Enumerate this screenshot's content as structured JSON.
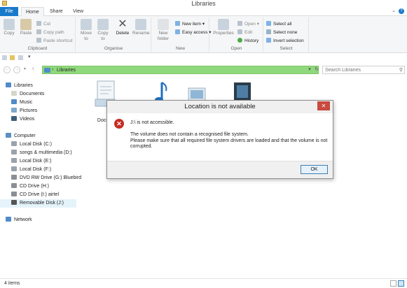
{
  "window": {
    "title": "Libraries"
  },
  "tabs": {
    "file": "File",
    "home": "Home",
    "share": "Share",
    "view": "View",
    "help": "?",
    "expand": "⌄"
  },
  "ribbon": {
    "clipboard": {
      "label": "Clipboard",
      "copy": "Copy",
      "paste": "Paste",
      "cut": "Cut",
      "copy_path": "Copy path",
      "paste_shortcut": "Paste shortcut"
    },
    "organise": {
      "label": "Organise",
      "move_to": "Move to",
      "copy_to": "Copy to",
      "delete": "Delete",
      "rename": "Rename"
    },
    "new": {
      "label": "New",
      "new_folder": "New folder",
      "new_item": "New item",
      "easy_access": "Easy access"
    },
    "open": {
      "label": "Open",
      "properties": "Properties",
      "open": "Open",
      "edit": "Edit",
      "history": "History"
    },
    "select": {
      "label": "Select",
      "select_all": "Select all",
      "select_none": "Select none",
      "invert_selection": "Invert selection"
    }
  },
  "address": {
    "path": "Libraries",
    "search_placeholder": "Search Libraries"
  },
  "nav": {
    "libraries": "Libraries",
    "documents": "Documents",
    "music": "Music",
    "pictures": "Pictures",
    "videos": "Videos",
    "computer": "Computer",
    "drives": [
      "Local Disk (C:)",
      "songs & multimedia (D:)",
      "Local Disk (E:)",
      "Local Disk (F:)",
      "DVD RW Drive (G:) Bluebird",
      "CD Drive (H:)",
      "CD Drive (I:) airtel",
      "Removable Disk (J:)"
    ],
    "network": "Network"
  },
  "content": {
    "libraries": [
      "Docum"
    ]
  },
  "status": {
    "items": "4 items"
  },
  "dialog": {
    "title": "Location is not available",
    "close": "✕",
    "message_title": "J:\\ is not accessible.",
    "message_body": "The volume does not contain a recognised file system.\nPlease make sure that all required file system drivers are loaded and that the volume is not corrupted.",
    "ok": "OK"
  },
  "colors": {
    "accent": "#1979ca",
    "address_bar": "#8fd87b",
    "error": "#c52b22",
    "close_button": "#c94a3f"
  }
}
